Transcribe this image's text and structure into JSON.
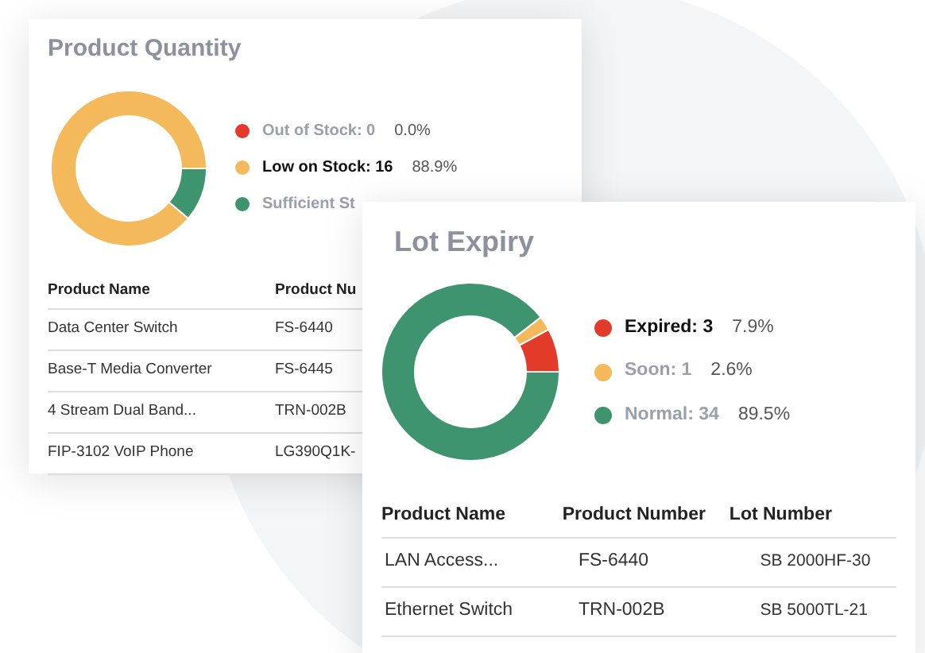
{
  "cards": [
    {
      "title": "Product Quantity",
      "chart_data": {
        "type": "donut",
        "values": [
          0,
          88.9,
          11.1
        ]
      },
      "legend": [
        {
          "label": "Out of Stock: 0",
          "percent": "0.0%",
          "color": "#e23b2a",
          "emphasized": false
        },
        {
          "label": "Low on Stock: 16",
          "percent": "88.9%",
          "color": "#f4b95a",
          "emphasized": true
        },
        {
          "label": "Sufficient St",
          "color": "#3f9470",
          "emphasized": false
        }
      ],
      "table": {
        "columns": [
          "Product Name",
          "Product Nu"
        ],
        "rows": [
          [
            "Data Center Switch",
            "FS-6440"
          ],
          [
            "Base-T Media Converter",
            "FS-6445"
          ],
          [
            "4 Stream Dual Band...",
            "TRN-002B"
          ],
          [
            "FIP-3102 VoIP Phone",
            "LG390Q1K-"
          ]
        ]
      }
    },
    {
      "title": "Lot Expiry",
      "chart_data": {
        "type": "donut",
        "values": [
          7.9,
          2.6,
          89.5
        ]
      },
      "legend": [
        {
          "label": "Expired: 3",
          "percent": "7.9%",
          "color": "#e23b2a",
          "emphasized": true
        },
        {
          "label": "Soon: 1",
          "percent": "2.6%",
          "color": "#f4b95a",
          "emphasized": false
        },
        {
          "label": "Normal: 34",
          "percent": "89.5%",
          "color": "#3f9470",
          "emphasized": false
        }
      ],
      "table": {
        "columns": [
          "Product Name",
          "Product Number",
          "Lot Number"
        ],
        "rows": [
          [
            "LAN Access...",
            "FS-6440",
            "SB 2000HF-30"
          ],
          [
            "Ethernet Switch",
            "TRN-002B",
            "SB 5000TL-21"
          ]
        ]
      }
    }
  ]
}
